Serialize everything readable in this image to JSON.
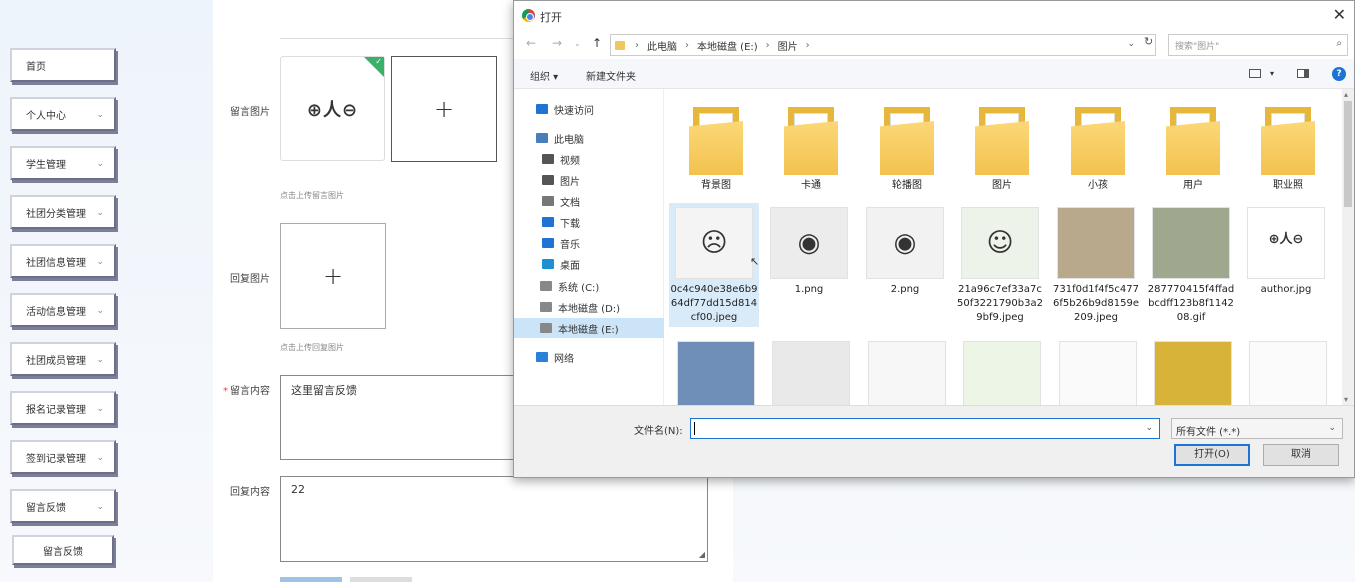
{
  "sidebar": {
    "items": [
      {
        "label": "首页",
        "chevron": false
      },
      {
        "label": "个人中心",
        "chevron": true
      },
      {
        "label": "学生管理",
        "chevron": true
      },
      {
        "label": "社团分类管理",
        "chevron": true
      },
      {
        "label": "社团信息管理",
        "chevron": true
      },
      {
        "label": "活动信息管理",
        "chevron": true
      },
      {
        "label": "社团成员管理",
        "chevron": true
      },
      {
        "label": "报名记录管理",
        "chevron": true
      },
      {
        "label": "签到记录管理",
        "chevron": true
      },
      {
        "label": "留言反馈",
        "chevron": true
      },
      {
        "label": "留言反馈",
        "chevron": false
      }
    ]
  },
  "form": {
    "message_image_label": "留言图片",
    "message_image_hint": "点击上传留言图片",
    "stamp_text": "⊕人⊖",
    "reply_image_label": "回复图片",
    "reply_image_hint": "点击上传回复图片",
    "message_content_label": "留言内容",
    "message_content_value": "这里留言反馈",
    "reply_content_label": "回复内容",
    "reply_content_value": "22"
  },
  "dialog": {
    "title": "打开",
    "breadcrumb": [
      "此电脑",
      "本地磁盘 (E:)",
      "图片"
    ],
    "search_placeholder": "搜索\"图片\"",
    "toolbar": {
      "organize": "组织 ▾",
      "new_folder": "新建文件夹"
    },
    "nav": [
      {
        "label": "快速访问",
        "icon": "star-icon",
        "color": "#1f74d3"
      },
      {
        "label": "此电脑",
        "icon": "computer-icon",
        "color": "#4a7ebb"
      },
      {
        "label": "视频",
        "icon": "video-icon",
        "color": "#555"
      },
      {
        "label": "图片",
        "icon": "picture-icon",
        "color": "#555"
      },
      {
        "label": "文档",
        "icon": "document-icon",
        "color": "#777"
      },
      {
        "label": "下载",
        "icon": "download-icon",
        "color": "#1f74d3"
      },
      {
        "label": "音乐",
        "icon": "music-icon",
        "color": "#1f74d3"
      },
      {
        "label": "桌面",
        "icon": "desktop-icon",
        "color": "#1f8fd3"
      },
      {
        "label": "系统 (C:)",
        "icon": "drive-c-icon",
        "color": "#888"
      },
      {
        "label": "本地磁盘 (D:)",
        "icon": "drive-d-icon",
        "color": "#888"
      },
      {
        "label": "本地磁盘 (E:)",
        "icon": "drive-e-icon",
        "color": "#888"
      },
      {
        "label": "网络",
        "icon": "network-icon",
        "color": "#2a7fd6"
      }
    ],
    "folders": [
      "背景图",
      "卡通",
      "轮播图",
      "图片",
      "小孩",
      "用户",
      "职业照"
    ],
    "files": [
      "0c4c940e38e6b964df77dd15d814cf00.jpeg",
      "1.png",
      "2.png",
      "21a96c7ef33a7c50f3221790b3a29bf9.jpeg",
      "731f0d1f4f5c4776f5b26b9d8159e209.jpeg",
      "287770415f4ffadbcdff123b8f114208.gif",
      "author.jpg"
    ],
    "filename_label": "文件名(N):",
    "filename_value": "",
    "filetype": "所有文件 (*.*)",
    "open_button": "打开(O)",
    "cancel_button": "取消"
  }
}
